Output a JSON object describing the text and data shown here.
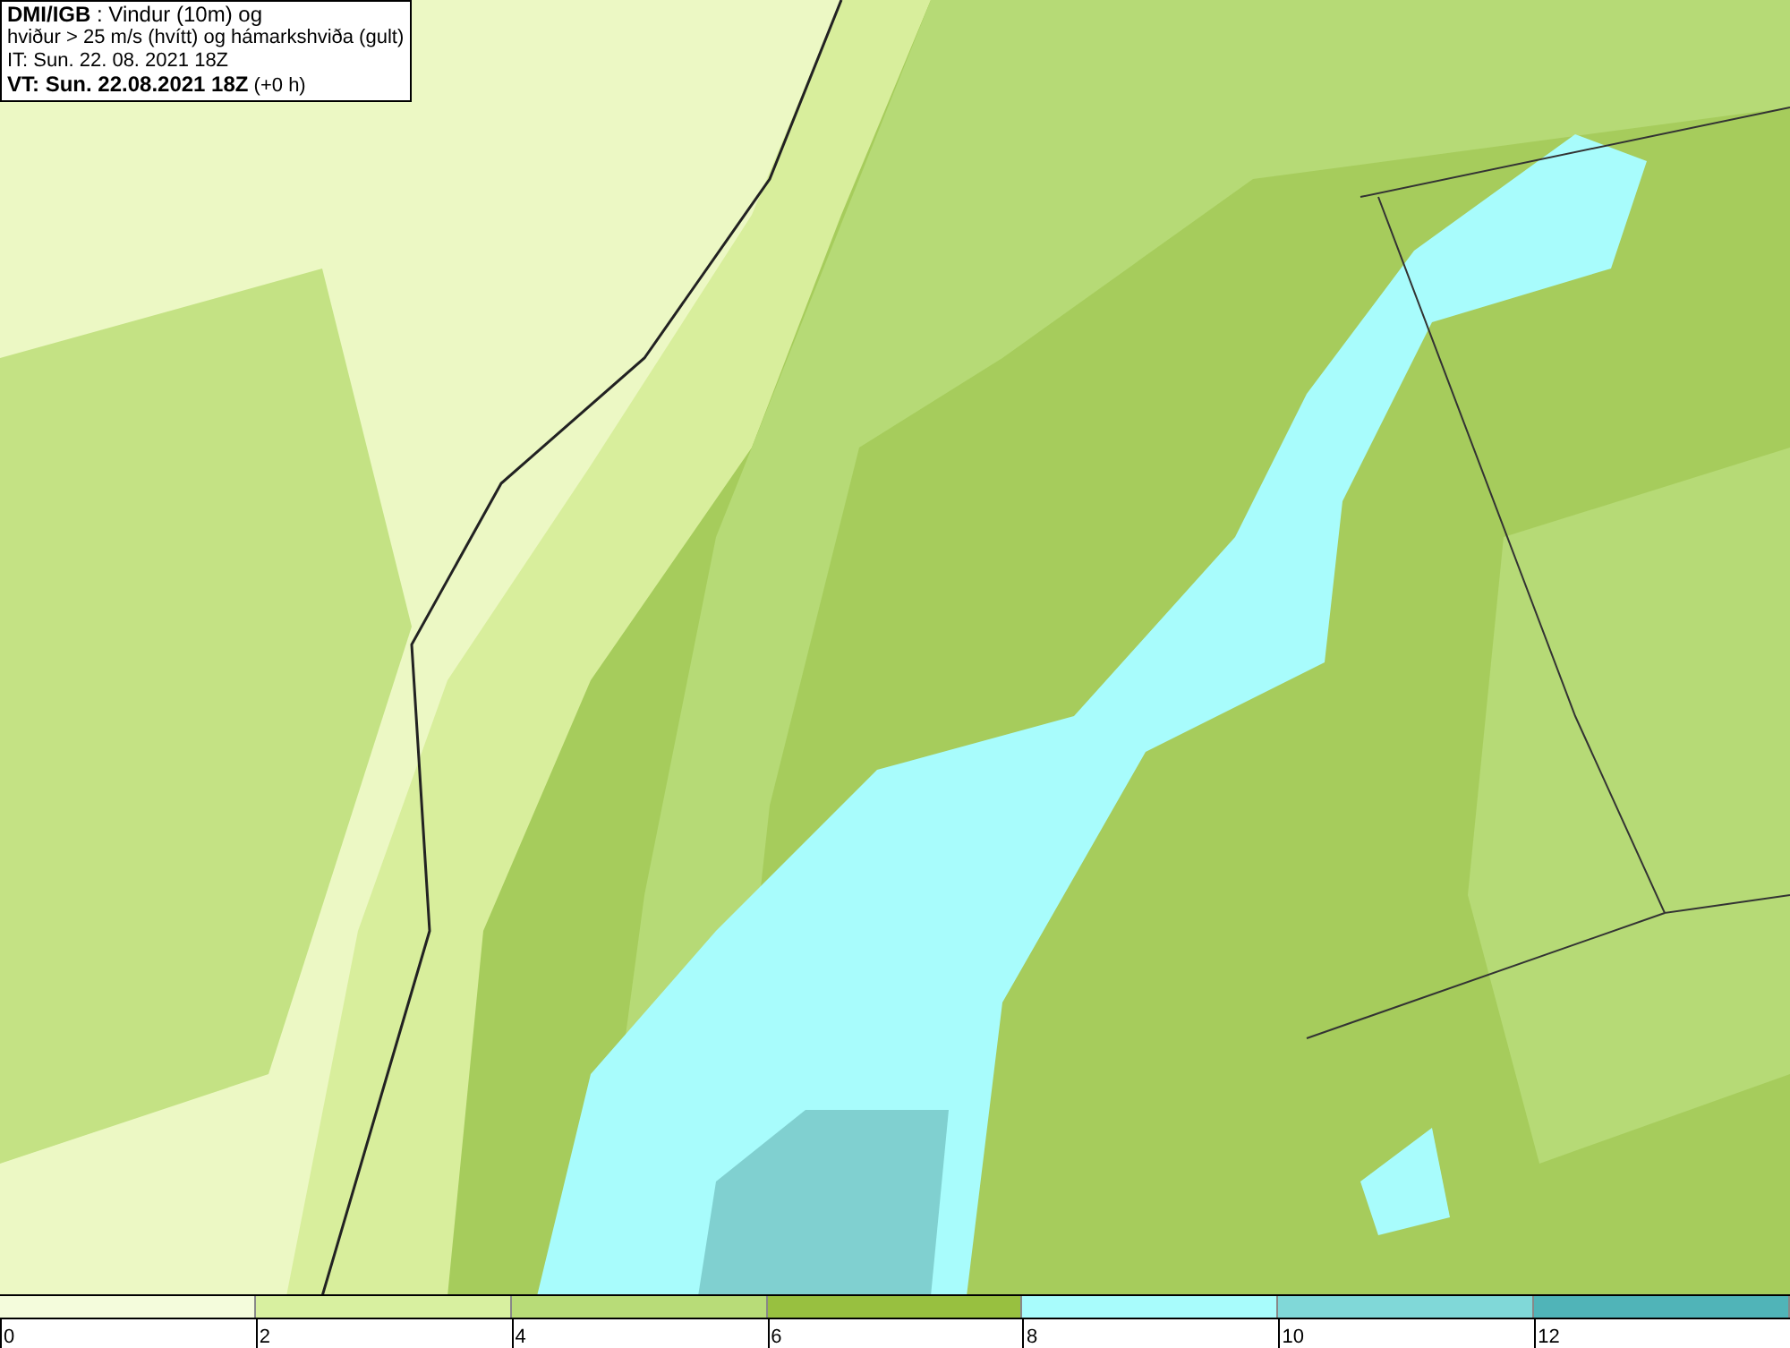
{
  "header": {
    "lines": [
      "**DMI/IGB** : Vindur (10m) og",
      "hviður > 25 m/s (hvítt) og hámarkshviða (gult)",
      "IT: Sun. 22. 08. 2021 18Z",
      "**VT: Sun. 22.08.2021 18Z** (+0 h)"
    ]
  },
  "legend": {
    "bins": [
      {
        "label": "0",
        "color": "#f4fcdc"
      },
      {
        "label": "2",
        "color": "#d8f0a0"
      },
      {
        "label": "4",
        "color": "#b8dc78"
      },
      {
        "label": "6",
        "color": "#98c040"
      },
      {
        "label": "8",
        "color": "#a8fcfc"
      },
      {
        "label": "10",
        "color": "#80d8d8"
      },
      {
        "label": "12",
        "color": "#50b4b8"
      }
    ]
  }
}
